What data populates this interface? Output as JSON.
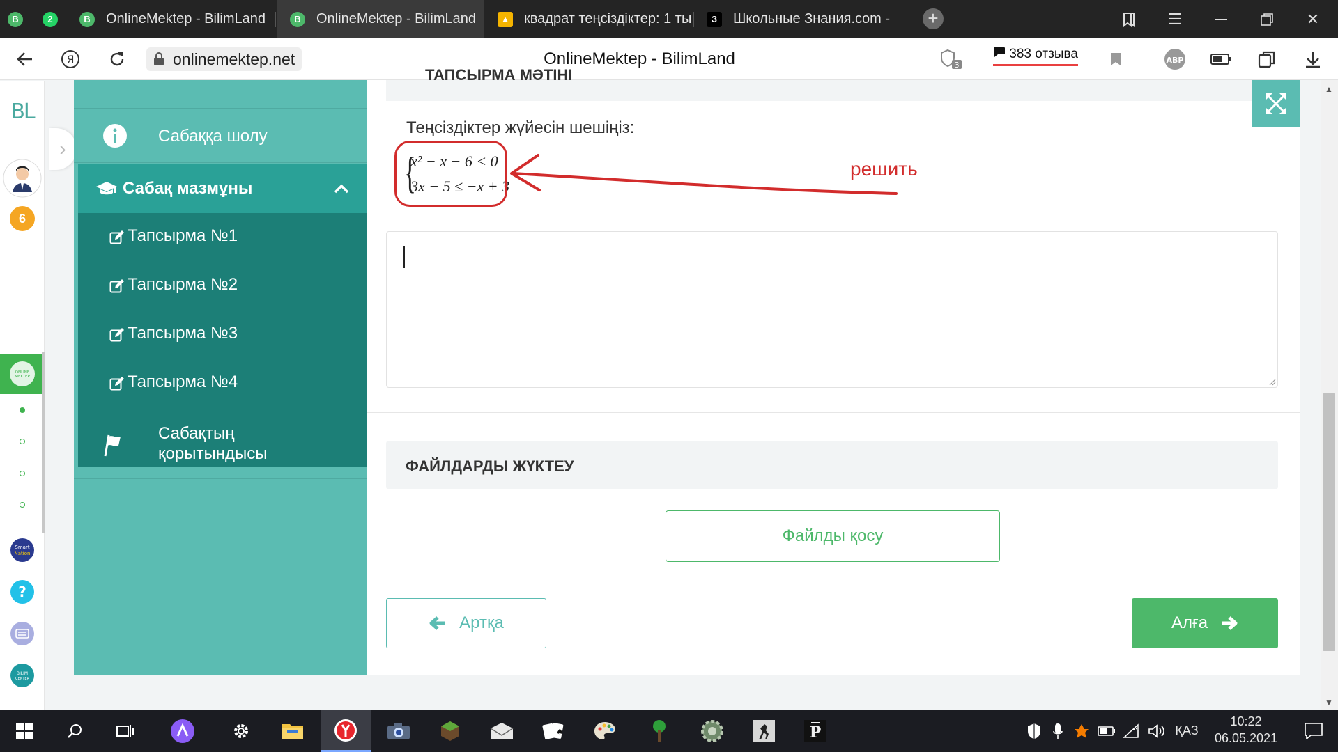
{
  "browser": {
    "tabs": [
      {
        "label": "",
        "favicon": "bilimland-icon",
        "badge": ""
      },
      {
        "label": "",
        "favicon": "whatsapp-icon",
        "badge": "2"
      },
      {
        "label": "OnlineMektep - BilimLand",
        "favicon": "bilimland-icon"
      },
      {
        "label": "OnlineMektep - BilimLand",
        "favicon": "bilimland-icon"
      },
      {
        "label": "квадрат теңсіздіктер: 1 ты",
        "favicon": "image-icon"
      },
      {
        "label": "Школьные Знания.com - ",
        "favicon": "znanija-icon",
        "favicon_text": "З"
      }
    ],
    "url": "onlinemektep.net",
    "page_title": "OnlineMektep - BilimLand",
    "reviews_label": "383 отзыва",
    "adblock_label": "ABP",
    "shield_count": "3"
  },
  "browser_sidebar": {
    "badge_count": "6",
    "logo_text": "BL"
  },
  "lesson_nav": {
    "items": [
      {
        "label": "Сабаққа шолу",
        "icon": "info-icon"
      },
      {
        "label": "Сабақ мазмұны",
        "icon": "graduation-cap-icon",
        "expanded": true
      },
      {
        "label": "Тапсырма №1",
        "icon": "edit-icon"
      },
      {
        "label": "Тапсырма №2",
        "icon": "edit-icon"
      },
      {
        "label": "Тапсырма №3",
        "icon": "edit-icon"
      },
      {
        "label": "Тапсырма №4",
        "icon": "edit-icon",
        "active": true
      },
      {
        "label": "Сабақтың\nқорытындысы",
        "icon": "flag-icon"
      }
    ]
  },
  "content": {
    "section_title": "ТАПСЫРМА МӘТІНІ",
    "question": "Теңсіздіктер жүйесін шешіңіз:",
    "formula_line1": "x² − x − 6 < 0",
    "formula_line2": "3x − 5 ≤ −x + 3",
    "annotation": "решить",
    "answer_value": "",
    "upload_title": "ФАЙЛДАРДЫ ЖҮКТЕУ",
    "add_file_label": "Файлды қосу",
    "back_label": "Артқа",
    "next_label": "Алға"
  },
  "taskbar": {
    "time": "10:22",
    "date": "06.05.2021",
    "language": "ҚАЗ"
  },
  "colors": {
    "teal": "#5bbcb2",
    "teal_dark": "#1c7f77",
    "green": "#4db86a",
    "annotation_red": "#d22c2c"
  }
}
